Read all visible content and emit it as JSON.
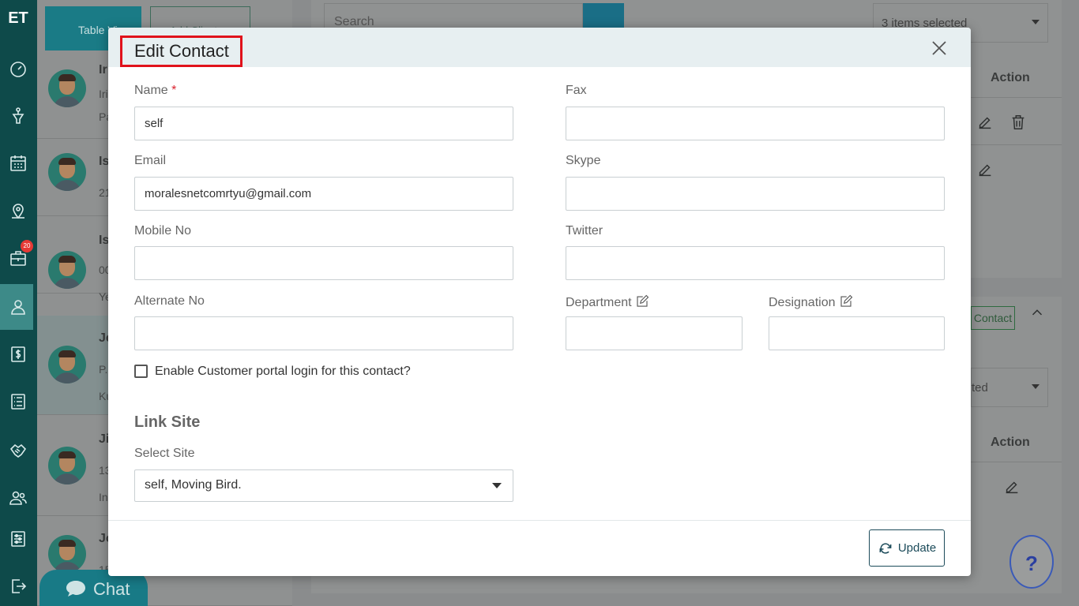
{
  "sidebar": {
    "logo": "ET",
    "badge": "20",
    "icons": [
      "dashboard-icon",
      "funnel-icon",
      "calendar-icon",
      "map-pin-icon",
      "briefcase-icon",
      "user-icon",
      "dollar-icon",
      "list-icon",
      "handshake-icon",
      "users-icon",
      "settings-icon",
      "logout-icon"
    ]
  },
  "background": {
    "table_view_label": "Table Vi",
    "add_client_label": "Add Client",
    "search_placeholder": "Search",
    "items_selected": "3 items selected",
    "items_selected_2": "ted",
    "action_header": "Action",
    "action_header_2": "Action",
    "contact_button": "Contact",
    "contacts": [
      {
        "name": "Ir",
        "line2": "Iri",
        "line3": "Pa"
      },
      {
        "name": "Is",
        "line2": "21",
        "line3": ""
      },
      {
        "name": "Is",
        "line2": "00",
        "line3": "Ye"
      },
      {
        "name": "Je",
        "line2": "P.",
        "line3": "Ku"
      },
      {
        "name": "Ji",
        "line2": "13",
        "line3": "In"
      },
      {
        "name": "Jo",
        "line2": "15",
        "line3": ""
      }
    ]
  },
  "chat": {
    "label": "Chat"
  },
  "help": {
    "label": "?"
  },
  "modal": {
    "title": "Edit Contact",
    "name_label": "Name",
    "required_mark": "*",
    "name_value": "self",
    "email_label": "Email",
    "email_value": "moralesnetcomrtyu@gmail.com",
    "mobile_label": "Mobile No",
    "mobile_value": "",
    "alternate_label": "Alternate No",
    "alternate_value": "",
    "fax_label": "Fax",
    "fax_value": "",
    "skype_label": "Skype",
    "skype_value": "",
    "twitter_label": "Twitter",
    "twitter_value": "",
    "department_label": "Department",
    "department_value": "",
    "designation_label": "Designation",
    "designation_value": "",
    "portal_checkbox_label": "Enable Customer portal login for this contact?",
    "portal_checked": false,
    "link_site_title": "Link Site",
    "select_site_label": "Select Site",
    "select_site_value": "self, Moving Bird.",
    "update_label": "Update"
  }
}
